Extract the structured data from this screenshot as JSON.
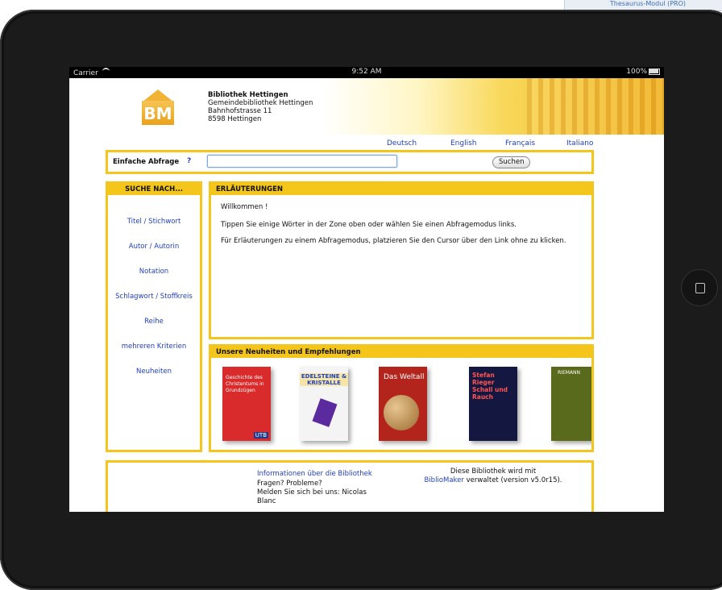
{
  "background_card": {
    "label": "Thesaurus-Modul (PRO)"
  },
  "status_bar": {
    "carrier": "Carrier",
    "time": "9:52 AM",
    "battery": "100%"
  },
  "library": {
    "name": "Bibliothek Hettingen",
    "line2": "Gemeindebibliothek Hettingen",
    "street": "Bahnhofstrasse 11",
    "city": "8598 Hettingen",
    "logo_text": "BM"
  },
  "languages": [
    "Deutsch",
    "English",
    "Français",
    "Italiano"
  ],
  "search": {
    "label": "Einfache Abfrage",
    "help": "?",
    "value": "",
    "button": "Suchen"
  },
  "sidebar": {
    "title": "SUCHE NACH...",
    "items": [
      "Titel / Stichwort",
      "Autor / Autorin",
      "Notation",
      "Schlagwort / Stoffkreis",
      "Reihe",
      "mehreren Kriterien",
      "Neuheiten"
    ]
  },
  "explanations": {
    "title": "ERLÄUTERUNGEN",
    "welcome": "Willkommen !",
    "line1": "Tippen Sie einige Wörter in der Zone oben oder wählen Sie einen Abfragemodus links.",
    "line2": "Für Erläuterungen zu einem Abfragemodus, platzieren Sie den Cursor über den Link ohne zu klicken."
  },
  "news": {
    "title": "Unsere Neuheiten und Empfehlungen",
    "books": [
      {
        "title": "Geschichte des Christentums in Grundzügen",
        "publisher": "UTB",
        "color": "#d92b2b"
      },
      {
        "title": "EDELSTEINE & KRISTALLE",
        "color": "#f4f4f4"
      },
      {
        "title": "Das Weltall",
        "color": "#b3241c"
      },
      {
        "title": "Stefan Rieger Schall und Rauch",
        "color": "#14173f"
      },
      {
        "title": "RIEMANN",
        "color": "#5a6a1c"
      }
    ]
  },
  "footer": {
    "info_link": "Informationen über die Bibliothek",
    "help": "Fragen? Probleme?",
    "contact": "Melden Sie sich bei uns: Nicolas Blanc",
    "managed_prefix": "Diese Bibliothek wird mit",
    "bibliomaker": "BiblioMaker",
    "managed_suffix": "verwaltet (version v5.0r15)."
  },
  "colors": {
    "accent": "#f4c61b",
    "link": "#1f3fbf",
    "bezel": "#1b1b1b"
  }
}
